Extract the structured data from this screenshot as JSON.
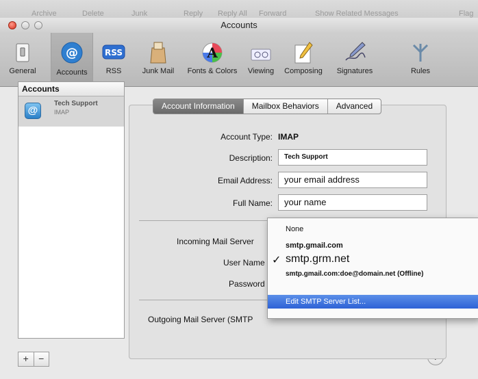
{
  "bg_toolbar": {
    "items": [
      "Archive",
      "Delete",
      "Junk",
      "Reply",
      "Reply All",
      "Forward",
      "Show Related Messages",
      "Flag"
    ]
  },
  "window": {
    "title": "Accounts"
  },
  "toolbar": {
    "items": [
      {
        "label": "General",
        "icon": "light-switch-icon"
      },
      {
        "label": "Accounts",
        "icon": "at-sign-icon",
        "selected": true
      },
      {
        "label": "RSS",
        "icon": "rss-icon"
      },
      {
        "label": "Junk Mail",
        "icon": "junk-mail-bag-icon"
      },
      {
        "label": "Fonts & Colors",
        "icon": "fonts-colors-icon"
      },
      {
        "label": "Viewing",
        "icon": "viewing-glasses-icon"
      },
      {
        "label": "Composing",
        "icon": "pencil-icon"
      },
      {
        "label": "Signatures",
        "icon": "signature-pen-icon"
      },
      {
        "label": "Rules",
        "icon": "rules-icon"
      }
    ]
  },
  "accounts_list": {
    "header": "Accounts",
    "items": [
      {
        "name": "Tech Support",
        "type": "IMAP"
      }
    ]
  },
  "tabs": [
    {
      "label": "Account Information",
      "active": true
    },
    {
      "label": "Mailbox Behaviors"
    },
    {
      "label": "Advanced"
    }
  ],
  "form": {
    "account_type_label": "Account Type:",
    "account_type_value": "IMAP",
    "description_label": "Description:",
    "description_value": "Tech Support",
    "email_label": "Email Address:",
    "email_value": "your email address",
    "fullname_label": "Full Name:",
    "fullname_value": "your name",
    "incoming_label": "Incoming Mail Server",
    "username_label": "User Name",
    "password_label": "Password",
    "outgoing_label": "Outgoing Mail Server (SMTP"
  },
  "smtp_menu": {
    "items": [
      {
        "label": "None"
      },
      {
        "label": "smtp.gmail.com"
      },
      {
        "label": "smtp.grm.net",
        "checked": true
      },
      {
        "label": "smtp.gmail.com:doe@domain.net (Offline)"
      },
      {
        "label": "Edit SMTP Server List...",
        "highlighted": true
      }
    ],
    "check_mark": "✓"
  },
  "bottom": {
    "add": "+",
    "remove": "−",
    "help": "?"
  },
  "colors": {
    "selection_blue": "#2e62d6",
    "active_tab": "#6a6a6a"
  }
}
